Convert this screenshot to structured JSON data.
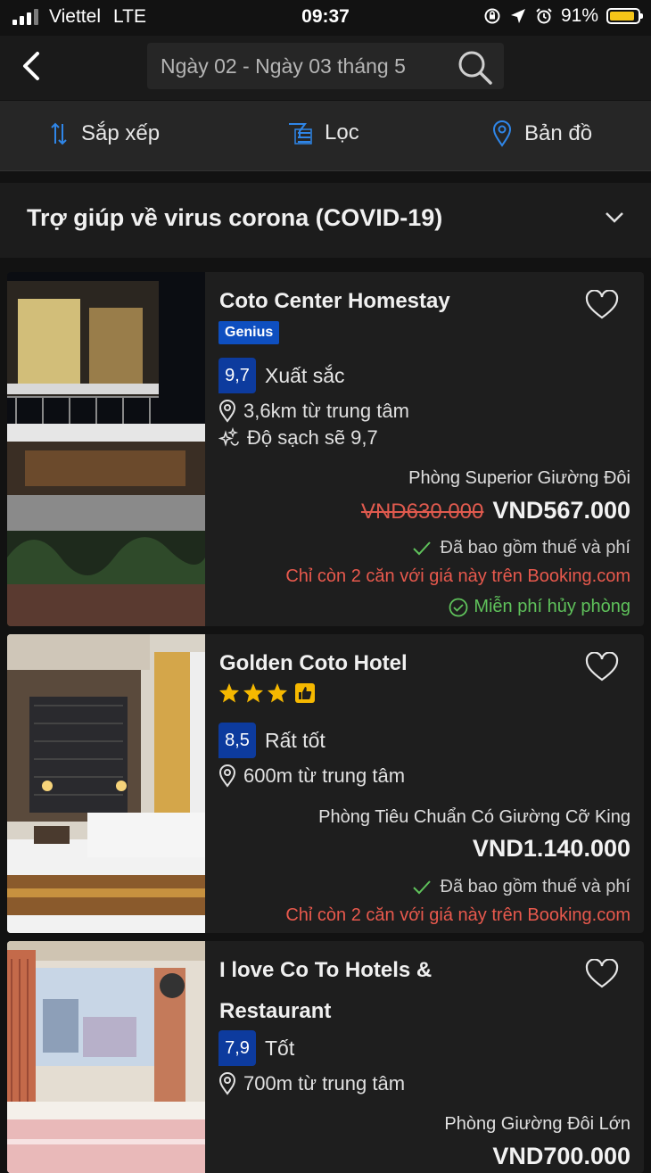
{
  "status_bar": {
    "carrier": "Viettel",
    "network": "LTE",
    "time": "09:37",
    "battery": "91%",
    "battery_level": 0.91
  },
  "header": {
    "search_text": "Ngày 02 - Ngày 03 tháng 5"
  },
  "filters": {
    "sort_label": "Sắp xếp",
    "filter_label": "Lọc",
    "map_label": "Bản đồ"
  },
  "covid_banner": {
    "title": "Trợ giúp về virus corona (COVID-19)"
  },
  "hotels": [
    {
      "name": "Coto Center Homestay",
      "badge": "Genius",
      "score": "9,7",
      "score_text": "Xuất sắc",
      "distance": "3,6km từ trung tâm",
      "cleanliness": "Độ sạch sẽ 9,7",
      "room": "Phòng Superior Giường Đôi",
      "old_price": "VND630.000",
      "price": "VND567.000",
      "tax_note": "Đã bao gồm thuế và phí",
      "scarcity": "Chỉ còn 2 căn với giá này trên Booking.com",
      "free_cancel": "Miễn phí hủy phòng"
    },
    {
      "name": "Golden Coto Hotel",
      "stars": 3,
      "score": "8,5",
      "score_text": "Rất tốt",
      "distance": "600m từ trung tâm",
      "room": "Phòng Tiêu Chuẩn Có Giường Cỡ King",
      "price": "VND1.140.000",
      "tax_note": "Đã bao gồm thuế và phí",
      "scarcity": "Chỉ còn 2 căn với giá này trên Booking.com"
    },
    {
      "name_line1": "I love Co To Hotels &",
      "name_line2": "Restaurant",
      "score": "7,9",
      "score_text": "Tốt",
      "distance": "700m từ trung tâm",
      "room": "Phòng Giường Đôi Lớn",
      "price": "VND700.000"
    }
  ],
  "colors": {
    "background": "#121212",
    "score_blue": "#0d3b9e",
    "genius_blue": "#0e4fc0",
    "accent_blue": "#2f86e8",
    "alert_red": "#e8594d",
    "success_green": "#5fc25b",
    "star_yellow": "#f5b800"
  }
}
